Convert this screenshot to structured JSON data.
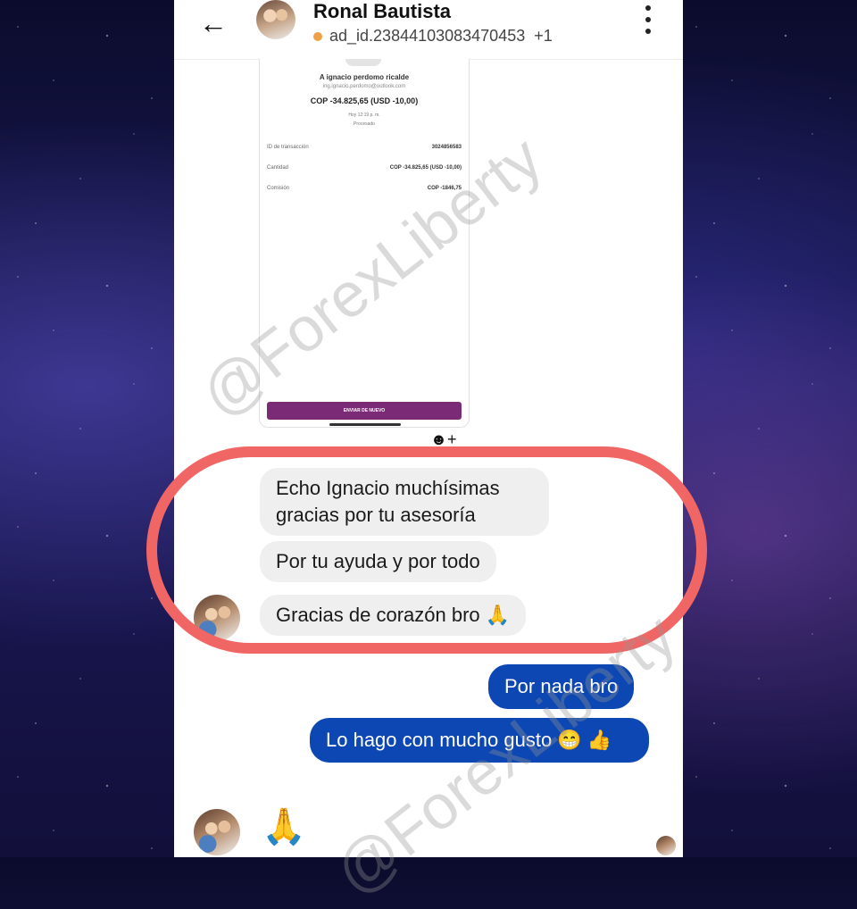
{
  "header": {
    "back_icon": "←",
    "name": "Ronal Bautista",
    "sub": "ad_id.23844103083470453",
    "extra": "+1",
    "status_color": "#f0a046"
  },
  "receipt": {
    "recipient": "A ignacio perdomo ricalde",
    "email": "ing.ignacio.perdomo@outlook.com",
    "amount": "COP -34.825,65 (USD -10,00)",
    "time": "Hoy 12:19 p. m.",
    "state": "Procesado",
    "rows": [
      {
        "label": "ID de transacción",
        "value": "3024856583"
      },
      {
        "label": "Cantidad",
        "value": "COP -34.825,65 (USD -10,00)"
      },
      {
        "label": "Comisión",
        "value": "COP -1846,75"
      }
    ],
    "button": "ENVIAR DE NUEVO"
  },
  "messages": {
    "in1": "Echo Ignacio muchísimas gracias por tu asesoría",
    "in2": "Por tu ayuda y por todo",
    "in3": "Gracias de corazón bro 🙏",
    "out1": "Por nada bro",
    "out2": "Lo hago con mucho gusto 😁 👍",
    "last_emoji": "🙏"
  },
  "react_icon": "☻+",
  "watermark": "@ForexLiberty",
  "colors": {
    "outgoing": "#0d47b3",
    "incoming": "#efefef",
    "highlight": "#f06665",
    "receipt_button": "#7b2a76"
  }
}
